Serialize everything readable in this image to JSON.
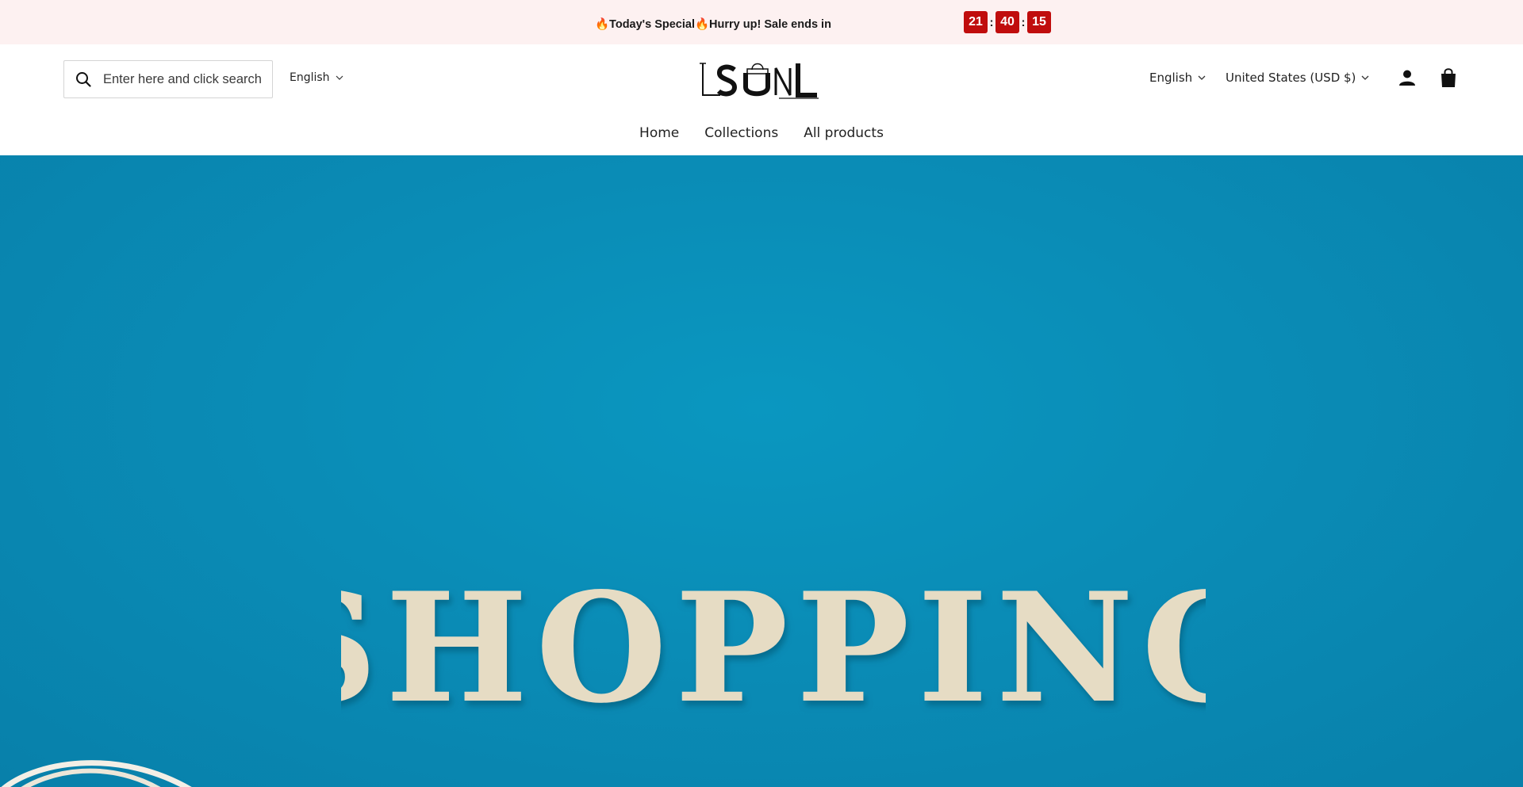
{
  "announcement": {
    "text": "🔥Today's Special🔥Hurry up! Sale ends in",
    "countdown": {
      "hours": "21",
      "minutes": "40",
      "seconds": "15",
      "separator": ":"
    }
  },
  "header": {
    "search": {
      "placeholder": "Enter here and click search",
      "icon": "search-icon"
    },
    "language_left": "English",
    "logo_text": "LSUNL",
    "language_right": "English",
    "currency": "United States (USD $)",
    "icons": [
      "account-icon",
      "cart-icon"
    ]
  },
  "nav": {
    "items": [
      {
        "label": "Home"
      },
      {
        "label": "Collections"
      },
      {
        "label": "All products"
      }
    ]
  },
  "hero": {
    "image_text": "SHOPPING",
    "background_color": "#0a8cb6"
  },
  "colors": {
    "announcement_bg": "#fdf1f1",
    "countdown_bg": "#c00d0d"
  }
}
